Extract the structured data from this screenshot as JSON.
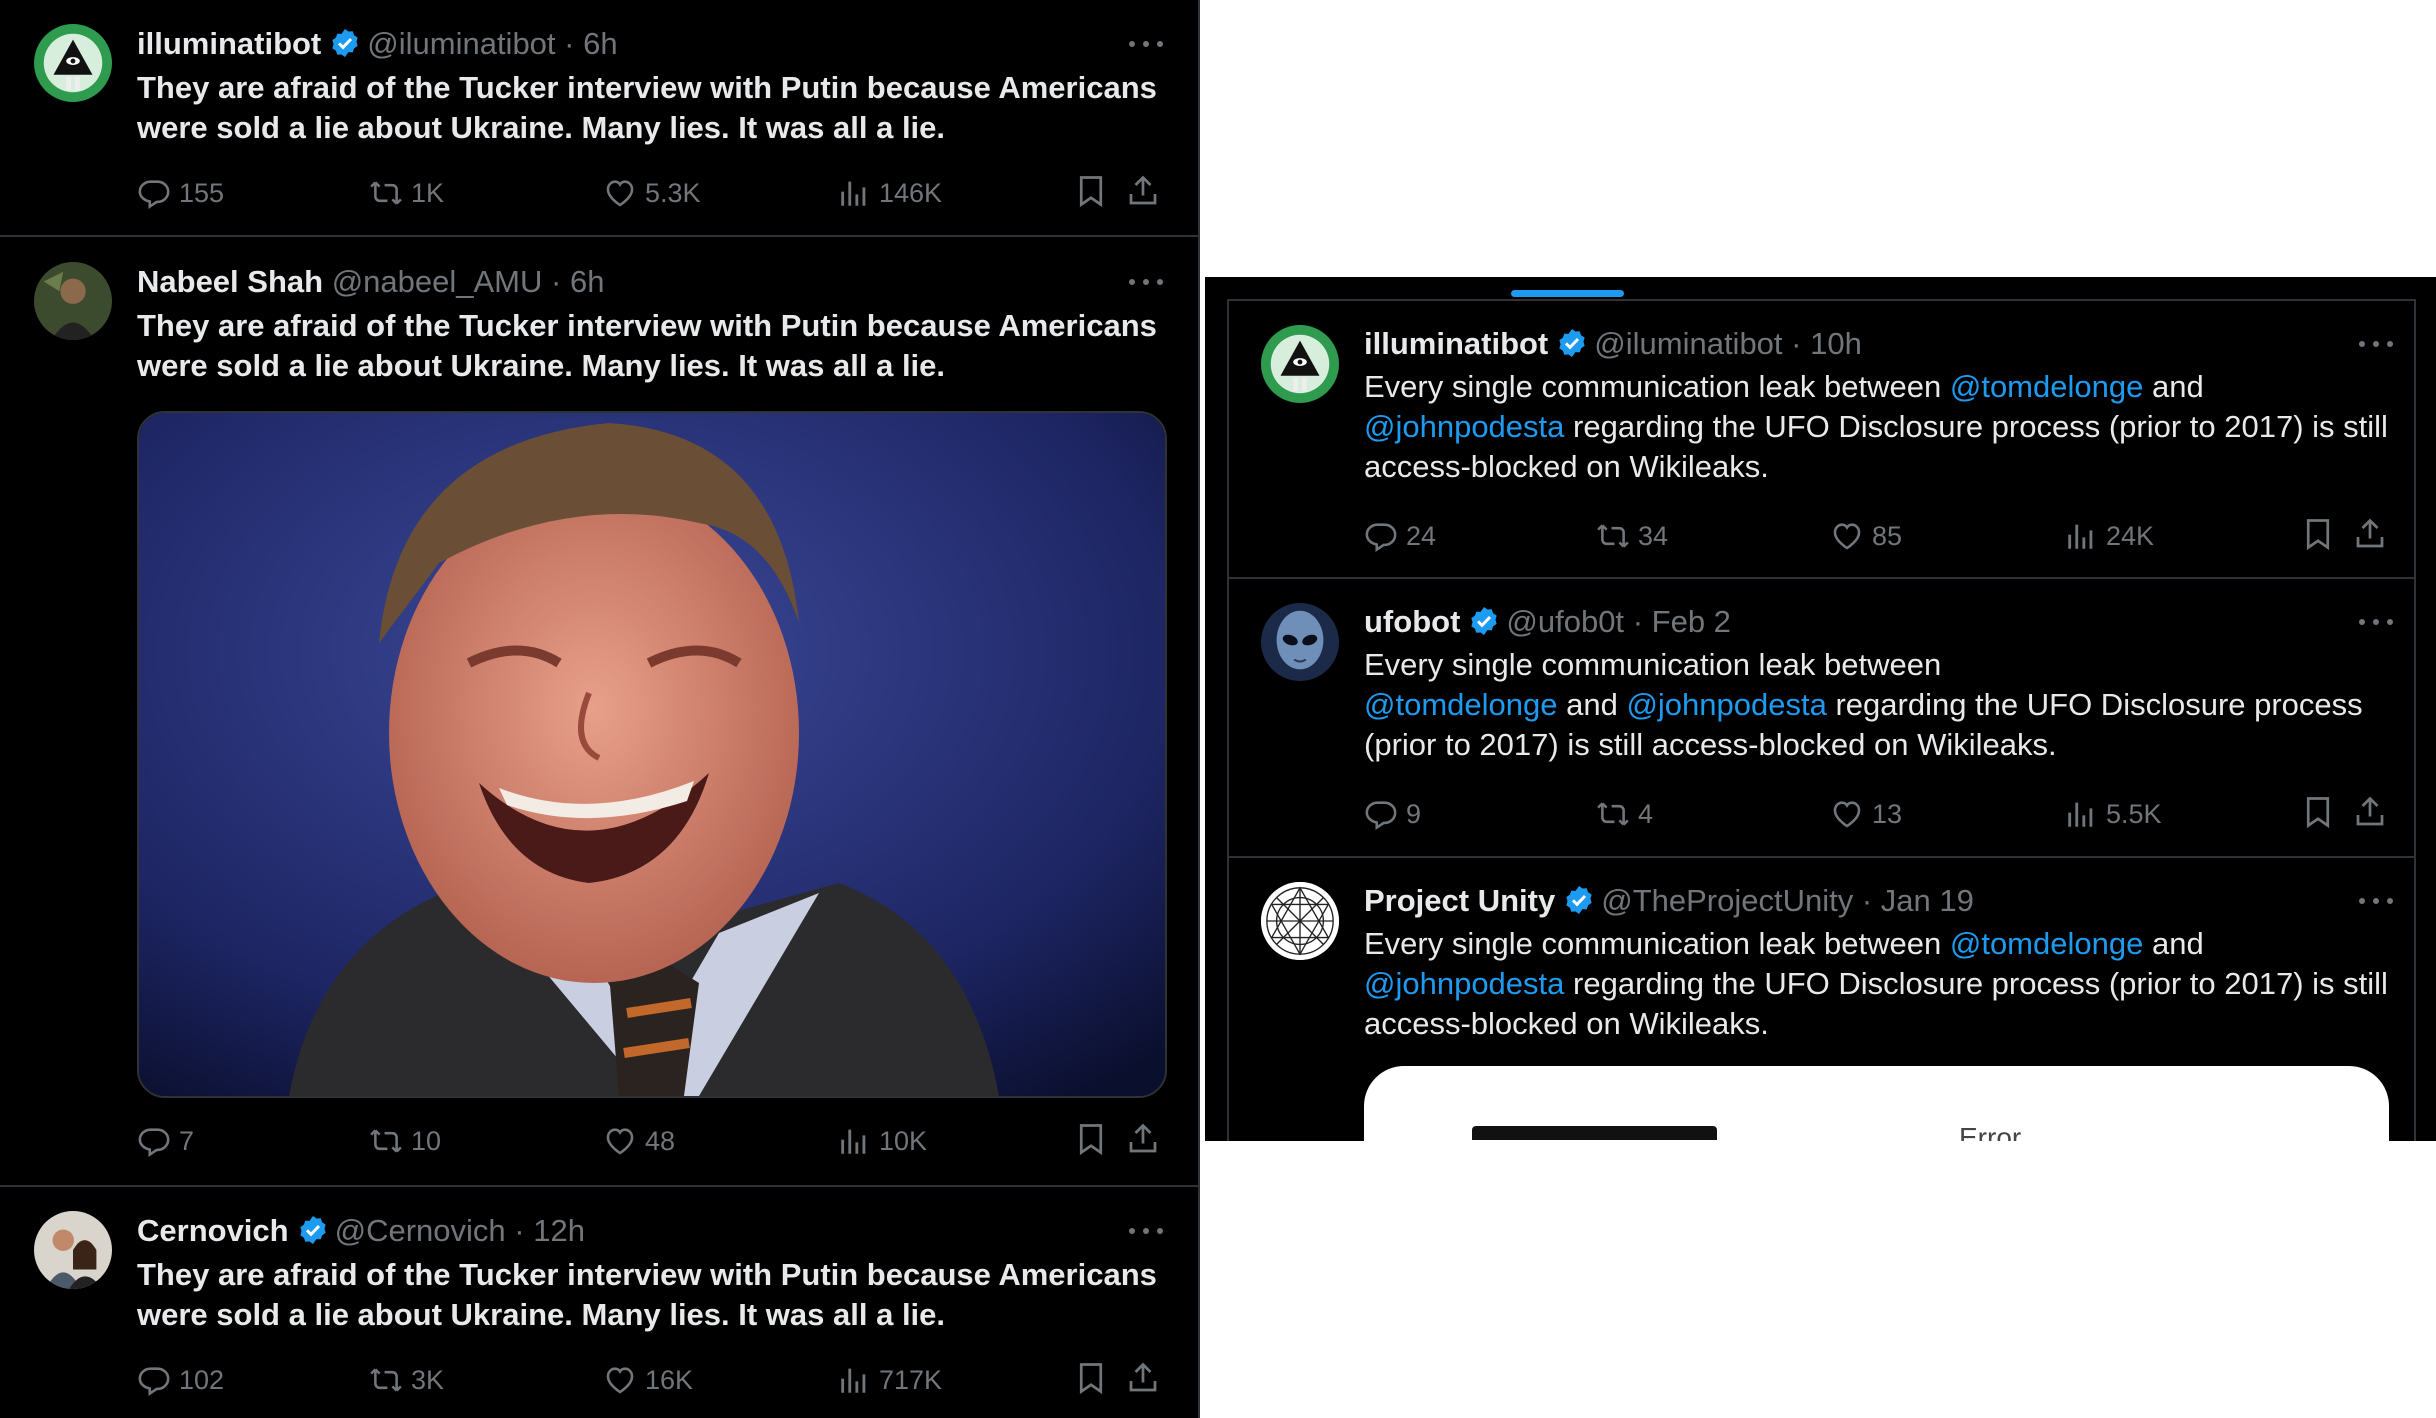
{
  "colors": {
    "background": "#000000",
    "text": "#e7e9ea",
    "muted": "#71767b",
    "accent": "#1d9bf0",
    "divider": "#2f3336"
  },
  "left_feed": [
    {
      "name": "illuminatibot",
      "verified": true,
      "handle": "@iluminatibot",
      "time": "6h",
      "text": "They are afraid of the Tucker interview with Putin because Americans were sold a lie about Ukraine. Many lies. It was all a lie.",
      "avatar_icon": "pyramid-eye-avatar",
      "stats": {
        "replies": "155",
        "reposts": "1K",
        "likes": "5.3K",
        "views": "146K"
      }
    },
    {
      "name": "Nabeel Shah",
      "verified": false,
      "handle": "@nabeel_AMU",
      "time": "6h",
      "text": "They are afraid of the Tucker interview with Putin because Americans were sold a lie about Ukraine. Many lies. It was all a lie.",
      "avatar_icon": "person-photo-avatar",
      "media": "laughing-man-in-suit-photo",
      "stats": {
        "replies": "7",
        "reposts": "10",
        "likes": "48",
        "views": "10K"
      }
    },
    {
      "name": "Cernovich",
      "verified": true,
      "handle": "@Cernovich",
      "time": "12h",
      "text": "They are afraid of the Tucker interview with Putin because Americans were sold a lie about Ukraine. Many lies. It was all a lie.",
      "avatar_icon": "couple-photo-avatar",
      "stats": {
        "replies": "102",
        "reposts": "3K",
        "likes": "16K",
        "views": "717K"
      }
    }
  ],
  "right_feed": [
    {
      "name": "illuminatibot",
      "verified": true,
      "handle": "@iluminatibot",
      "time": "10h",
      "text_parts": [
        "Every single communication leak between ",
        "@tomdelonge",
        " and ",
        "@johnpodesta",
        " regarding the UFO Disclosure process (prior to 2017) is still access-blocked on Wikileaks."
      ],
      "stats": {
        "replies": "24",
        "reposts": "34",
        "likes": "85",
        "views": "24K"
      }
    },
    {
      "name": "ufobot",
      "verified": true,
      "handle": "@ufob0t",
      "time": "Feb 2",
      "text_parts": [
        "Every single communication leak between",
        "@tomdelonge",
        " and ",
        "@johnpodesta",
        " regarding the UFO Disclosure process (prior to 2017) is still access-blocked on Wikileaks."
      ],
      "stats": {
        "replies": "9",
        "reposts": "4",
        "likes": "13",
        "views": "5.5K"
      }
    },
    {
      "name": "Project Unity",
      "verified": true,
      "handle": "@TheProjectUnity",
      "time": "Jan 19",
      "text_parts": [
        "Every single communication leak between ",
        "@tomdelonge",
        " and ",
        "@johnpodesta",
        " regarding the UFO Disclosure process (prior to 2017) is still access-blocked on Wikileaks."
      ],
      "card_title": "Error"
    }
  ],
  "separator": "·"
}
